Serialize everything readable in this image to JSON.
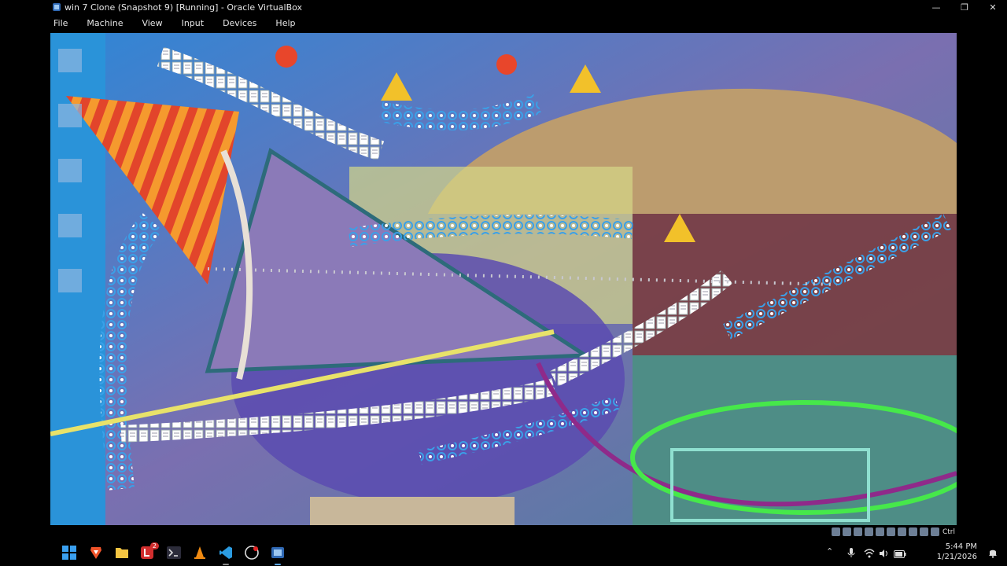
{
  "window": {
    "title": "win 7 Clone (Snapshot 9) [Running] - Oracle VirtualBox",
    "controls": {
      "minimize": "—",
      "restore": "❐",
      "close": "✕"
    }
  },
  "menubar": {
    "items": [
      "File",
      "Machine",
      "View",
      "Input",
      "Devices",
      "Help"
    ]
  },
  "vm": {
    "status_bar": {
      "host_key": "Ctrl"
    }
  },
  "taskbar": {
    "apps": [
      {
        "name": "start",
        "icon": "windows-logo-icon"
      },
      {
        "name": "brave",
        "icon": "brave-browser-icon"
      },
      {
        "name": "file-explorer",
        "icon": "folder-icon"
      },
      {
        "name": "app-l",
        "icon": "l-app-icon",
        "badge": "2"
      },
      {
        "name": "terminal",
        "icon": "terminal-icon"
      },
      {
        "name": "vlc",
        "icon": "vlc-cone-icon"
      },
      {
        "name": "vscode",
        "icon": "vscode-icon"
      },
      {
        "name": "obs",
        "icon": "record-icon"
      },
      {
        "name": "virtualbox",
        "icon": "virtualbox-icon"
      }
    ]
  },
  "tray": {
    "time": "5:44 PM",
    "date": "1/21/2026"
  },
  "colors": {
    "accent": "#0078d4",
    "vm_background": "#3b8ccd"
  }
}
